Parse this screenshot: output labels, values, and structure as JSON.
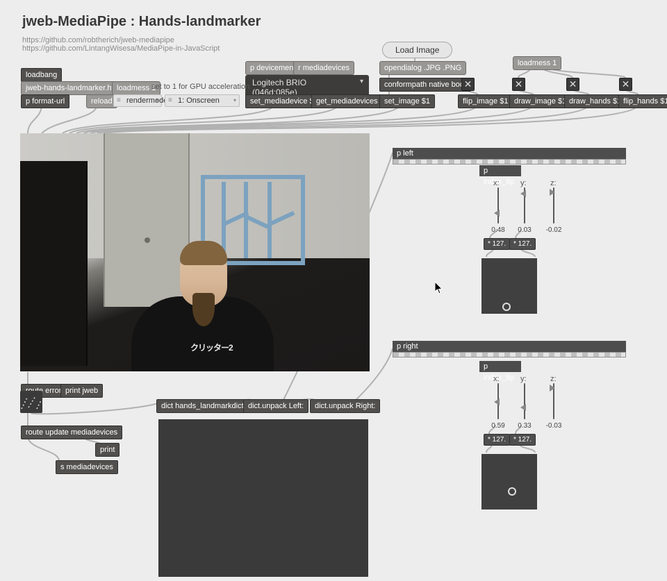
{
  "title": "jweb-MediaPipe : Hands-landmarker",
  "links": {
    "l1": "https://github.com/robtherich/jweb-mediapipe",
    "l2": "https://github.com/LintangWisesa/MediaPipe-in-JavaScript"
  },
  "textbutton": {
    "loadimage": "Load Image"
  },
  "dropdown": {
    "device": "Logitech BRIO (046d:085e)"
  },
  "objects": {
    "loadbang": "loadbang",
    "jwebhtml": "jweb-hands-landmarker.html",
    "loadmess1a": "loadmess 1",
    "comment_gpu": "set to 1 for GPU acceleration",
    "pformaturl": "p format-url",
    "reload": "reload",
    "pdevicemenu": "p devicemenu",
    "rmediadevices": "r mediadevices",
    "setmediadevice": "set_mediadevice $1",
    "getmediadevices": "get_mediadevices",
    "opendialog": "opendialog .JPG .PNG",
    "conformpath": "conformpath native boot",
    "setimage": "set_image $1",
    "loadmess1b": "loadmess 1",
    "flipimage": "flip_image $1",
    "drawimage": "draw_image $1",
    "drawhands": "draw_hands $1",
    "fliphands": "flip_hands $1",
    "routeerror": "route error",
    "printjweb": "print jweb",
    "dictlandmark": "dict hands_landmarkdict",
    "dictleft": "dict.unpack Left:",
    "dictright": "dict.unpack Right:",
    "routeupdate": "route update mediadevices",
    "print": "print",
    "smediadevices": "s mediadevices",
    "pleft": "p left",
    "pright": "p right",
    "pindextip_a": "p index_tip",
    "pindextip_b": "p index_tip",
    "x": "x:",
    "y": "y:",
    "z": "z:",
    "mul127": "* 127."
  },
  "umenu": {
    "rendermode": "rendermode",
    "onscreen": "1: Onscreen"
  },
  "toggles": {
    "x_on": "✕",
    "x_off": ""
  },
  "hands": {
    "left": {
      "x": "0.48",
      "y": "0.03",
      "z": "-0.02",
      "padx": 0.48,
      "pady": 0.9
    },
    "right": {
      "x": "0.59",
      "y": "0.33",
      "z": "-0.03",
      "padx": 0.58,
      "pady": 0.7
    }
  },
  "shirt": "クリッター2"
}
